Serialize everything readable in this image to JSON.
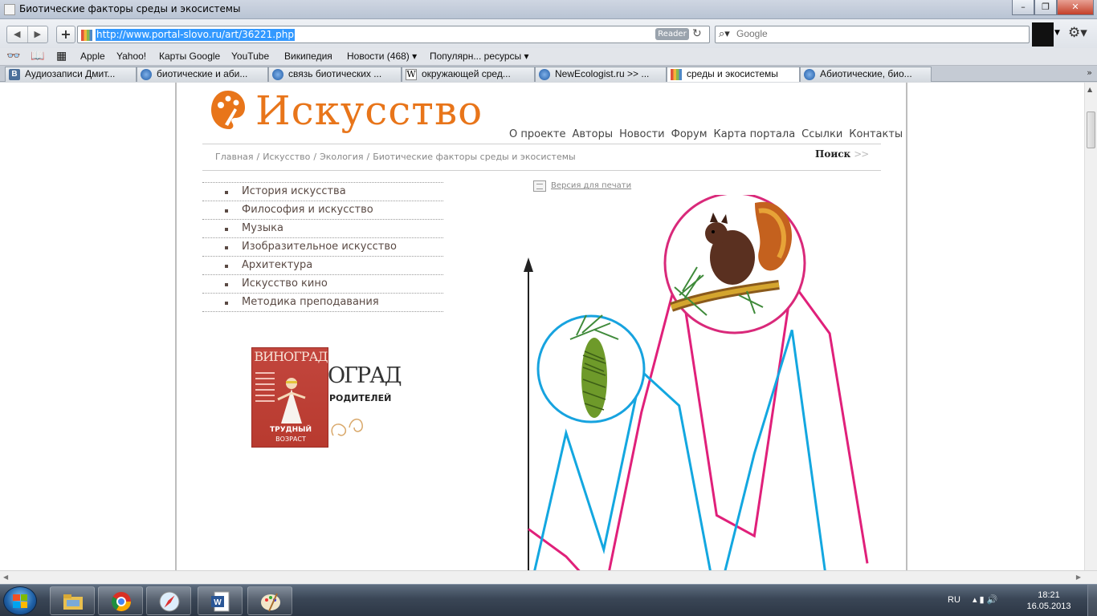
{
  "window": {
    "title": "Биотические факторы среды и экосистемы",
    "minimize": "–",
    "maximize": "❐",
    "close": "✕"
  },
  "toolbar": {
    "back": "◀",
    "forward": "▶",
    "add": "+",
    "url": "http://www.portal-slovo.ru/art/36221.php",
    "reader_label": "Reader",
    "reload": "↻",
    "search_placeholder": "Google",
    "search_icon": "⌕▾",
    "settings_icon": "⚙▾"
  },
  "bookmarks": {
    "reading_list_icon": "👓",
    "book_icon": "📖",
    "grid_icon": "▦",
    "items": [
      "Apple",
      "Yahoo!",
      "Карты Google",
      "YouTube",
      "Википедия",
      "Новости (468) ▾",
      "Популярн... ресурсы ▾"
    ]
  },
  "tabs": {
    "items": [
      {
        "label": "Аудиозаписи Дмит...",
        "icon": "vk"
      },
      {
        "label": "биотические и аби...",
        "icon": "globe"
      },
      {
        "label": "связь биотических ...",
        "icon": "globe"
      },
      {
        "label": "окружающей сред...",
        "icon": "wiki"
      },
      {
        "label": "NewEcologist.ru >> ...",
        "icon": "globe"
      },
      {
        "label": "среды и экосистемы",
        "icon": "isk"
      },
      {
        "label": "Абиотические, био...",
        "icon": "globe"
      }
    ],
    "more": "»",
    "vk_glyph": "В",
    "wiki_glyph": "W"
  },
  "page": {
    "logo": "Искусство",
    "nav": [
      "О проекте",
      "Авторы",
      "Новости",
      "Форум",
      "Карта портала",
      "Ссылки",
      "Контакты"
    ],
    "breadcrumbs": [
      "Главная",
      "Искусство",
      "Экология",
      "Биотические факторы среды и экосистемы"
    ],
    "breadcrumb_sep": "/",
    "search_label": "Поиск",
    "search_arrows": ">>",
    "menu": [
      "История искусства",
      "Философия и искусство",
      "Музыка",
      "Изобразительное искусство",
      "Архитектура",
      "Искусство кино",
      "Методика преподавания"
    ],
    "magazine": {
      "title": "ВИНОГРАД",
      "subtitle1": "ТРУДНЫЙ",
      "subtitle2": "ВОЗРАСТ",
      "banner_word": "ОГРАД",
      "banner_sub": "РОДИТЕЛЕЙ"
    },
    "print_label": "Версия для печати"
  },
  "chart_data": {
    "type": "line",
    "title": "",
    "xlabel": "",
    "ylabel": "",
    "series": [
      {
        "color": "#e0207a",
        "values": [
          0.12,
          0.04,
          -0.08,
          0.46,
          0.88,
          0.16,
          0.1,
          0.84,
          0.69,
          0.02
        ]
      },
      {
        "color": "#13a7e0",
        "values": [
          -0.08,
          0.4,
          0.06,
          0.58,
          0.48,
          -0.1,
          0.34,
          0.7,
          -0.1,
          -0.1
        ]
      }
    ],
    "images": [
      {
        "icon": "squirrel-icon",
        "ring_color": "#d9297a"
      },
      {
        "icon": "pine-cone-icon",
        "ring_color": "#17a3df"
      }
    ]
  },
  "taskbar": {
    "lang": "RU",
    "tray_icons": "▴ ▮ 🔊",
    "time": "18:21",
    "date": "16.05.2013"
  }
}
